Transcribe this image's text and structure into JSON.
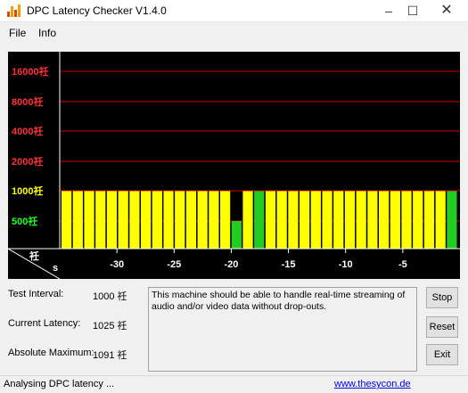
{
  "window": {
    "title": "DPC Latency Checker V1.4.0"
  },
  "colors": {
    "good": "#22cc22",
    "warn": "#ffff00",
    "bad": "#ff0000",
    "bg": "#000000",
    "grid": "#cc0000"
  },
  "menu": {
    "items": [
      {
        "label": "File"
      },
      {
        "label": "Info"
      }
    ]
  },
  "chart_data": {
    "type": "bar",
    "title": "",
    "y_tick_labels": [
      "16000祍",
      "8000祍",
      "4000祍",
      "2000祍",
      "1000祍",
      "500祍"
    ],
    "y_tick_colors": [
      "#ff3333",
      "#ff3333",
      "#ff3333",
      "#ff3333",
      "#ffff00",
      "#22ff22"
    ],
    "ylabel": "祍",
    "xlabel": "s",
    "x_tick_labels": [
      "-30",
      "-25",
      "-20",
      "-15",
      "-10",
      "-5"
    ],
    "x_range": [
      -35,
      0
    ],
    "y_scale": "log2",
    "grid": true,
    "bars": [
      {
        "t": -35,
        "value": 1000,
        "color": "yellow"
      },
      {
        "t": -34,
        "value": 1000,
        "color": "yellow"
      },
      {
        "t": -33,
        "value": 1000,
        "color": "yellow"
      },
      {
        "t": -32,
        "value": 1000,
        "color": "yellow"
      },
      {
        "t": -31,
        "value": 1000,
        "color": "yellow"
      },
      {
        "t": -30,
        "value": 1000,
        "color": "yellow"
      },
      {
        "t": -29,
        "value": 1000,
        "color": "yellow"
      },
      {
        "t": -28,
        "value": 1000,
        "color": "yellow"
      },
      {
        "t": -27,
        "value": 1000,
        "color": "yellow"
      },
      {
        "t": -26,
        "value": 1000,
        "color": "yellow"
      },
      {
        "t": -25,
        "value": 1000,
        "color": "yellow"
      },
      {
        "t": -24,
        "value": 1000,
        "color": "yellow"
      },
      {
        "t": -23,
        "value": 1000,
        "color": "yellow"
      },
      {
        "t": -22,
        "value": 1000,
        "color": "yellow"
      },
      {
        "t": -21,
        "value": 1000,
        "color": "yellow"
      },
      {
        "t": -20,
        "value": 500,
        "color": "green"
      },
      {
        "t": -19,
        "value": 1000,
        "color": "yellow"
      },
      {
        "t": -18,
        "value": 1000,
        "color": "green"
      },
      {
        "t": -17,
        "value": 1000,
        "color": "yellow"
      },
      {
        "t": -16,
        "value": 1000,
        "color": "yellow"
      },
      {
        "t": -15,
        "value": 1000,
        "color": "yellow"
      },
      {
        "t": -14,
        "value": 1000,
        "color": "yellow"
      },
      {
        "t": -13,
        "value": 1000,
        "color": "yellow"
      },
      {
        "t": -12,
        "value": 1000,
        "color": "yellow"
      },
      {
        "t": -11,
        "value": 1000,
        "color": "yellow"
      },
      {
        "t": -10,
        "value": 1000,
        "color": "yellow"
      },
      {
        "t": -9,
        "value": 1000,
        "color": "yellow"
      },
      {
        "t": -8,
        "value": 1000,
        "color": "yellow"
      },
      {
        "t": -7,
        "value": 1000,
        "color": "yellow"
      },
      {
        "t": -6,
        "value": 1000,
        "color": "yellow"
      },
      {
        "t": -5,
        "value": 1000,
        "color": "yellow"
      },
      {
        "t": -4,
        "value": 1000,
        "color": "yellow"
      },
      {
        "t": -3,
        "value": 1000,
        "color": "yellow"
      },
      {
        "t": -2,
        "value": 1000,
        "color": "yellow"
      },
      {
        "t": -1,
        "value": 1000,
        "color": "green"
      }
    ]
  },
  "stats": {
    "test_interval_label": "Test Interval:",
    "test_interval_value": "1000 祍",
    "current_latency_label": "Current Latency:",
    "current_latency_value": "1025 祍",
    "absolute_maximum_label": "Absolute Maximum:",
    "absolute_maximum_value": "1091 祍"
  },
  "message": "This machine should be able to handle real-time streaming of audio and/or video data without drop-outs.",
  "buttons": {
    "stop": "Stop",
    "reset": "Reset",
    "exit": "Exit"
  },
  "status": {
    "text": "Analysing DPC latency ...",
    "link": "www.thesycon.de"
  }
}
